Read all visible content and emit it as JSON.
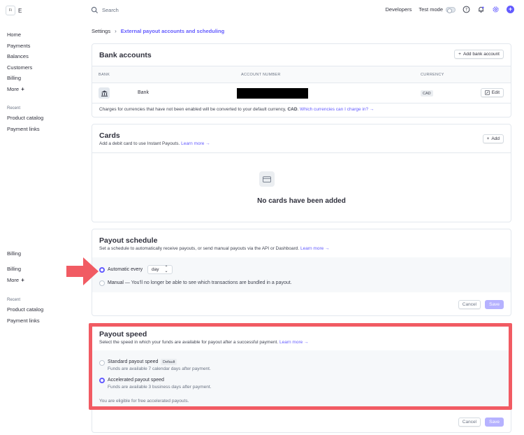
{
  "brand": {
    "logo_text": "Fi",
    "name": "E"
  },
  "sidebar": {
    "items": [
      {
        "label": "Home"
      },
      {
        "label": "Payments"
      },
      {
        "label": "Balances"
      },
      {
        "label": "Customers"
      },
      {
        "label": "Billing"
      },
      {
        "label": "More"
      }
    ],
    "recent_heading": "Recent",
    "recent": [
      {
        "label": "Product catalog"
      },
      {
        "label": "Payment links"
      }
    ],
    "lower": {
      "billing_label": "Billing",
      "items": [
        {
          "label": "Billing"
        },
        {
          "label": "More"
        }
      ],
      "recent_heading": "Recent",
      "recent": [
        {
          "label": "Product catalog"
        },
        {
          "label": "Payment links"
        }
      ]
    }
  },
  "topbar": {
    "search_placeholder": "Search",
    "developers": "Developers",
    "test_mode": "Test mode"
  },
  "breadcrumb": {
    "root": "Settings",
    "current": "External payout accounts and scheduling"
  },
  "bank_accounts": {
    "title": "Bank accounts",
    "add_button": "Add bank account",
    "columns": {
      "bank": "BANK",
      "account_number": "ACCOUNT NUMBER",
      "currency": "CURRENCY"
    },
    "row": {
      "bank": "Bank",
      "currency": "CAD",
      "edit": "Edit"
    },
    "note_prefix": "Charges for currencies that have not been enabled will be converted to your default currency, ",
    "note_currency": "CAD",
    "note_link": "Which currencies can I charge in? →"
  },
  "cards": {
    "title": "Cards",
    "description": "Add a debit card to use Instant Payouts.",
    "learn_more": "Learn more →",
    "add_button": "Add",
    "empty_title": "No cards have been added"
  },
  "payout_schedule": {
    "title": "Payout schedule",
    "description": "Set a schedule to automatically receive payouts, or send manual payouts via the API or Dashboard.",
    "learn_more": "Learn more →",
    "automatic_label": "Automatic every",
    "interval": "day",
    "manual_label": "Manual",
    "manual_note": "— You'll no longer be able to see which transactions are bundled in a payout.",
    "cancel": "Cancel",
    "save": "Save"
  },
  "payout_speed": {
    "title": "Payout speed",
    "description": "Select the speed in which your funds are available for payout after a successful payment.",
    "learn_more": "Learn more →",
    "standard_label": "Standard payout speed",
    "standard_badge": "Default",
    "standard_note": "Funds are available 7 calendar days after payment.",
    "accelerated_label": "Accelerated payout speed",
    "accelerated_note": "Funds are available 3 business days after payment.",
    "eligibility": "You are eligible for free accelerated payouts.",
    "cancel": "Cancel",
    "save": "Save"
  },
  "colors": {
    "accent": "#635bff",
    "highlight": "#f15b63"
  }
}
